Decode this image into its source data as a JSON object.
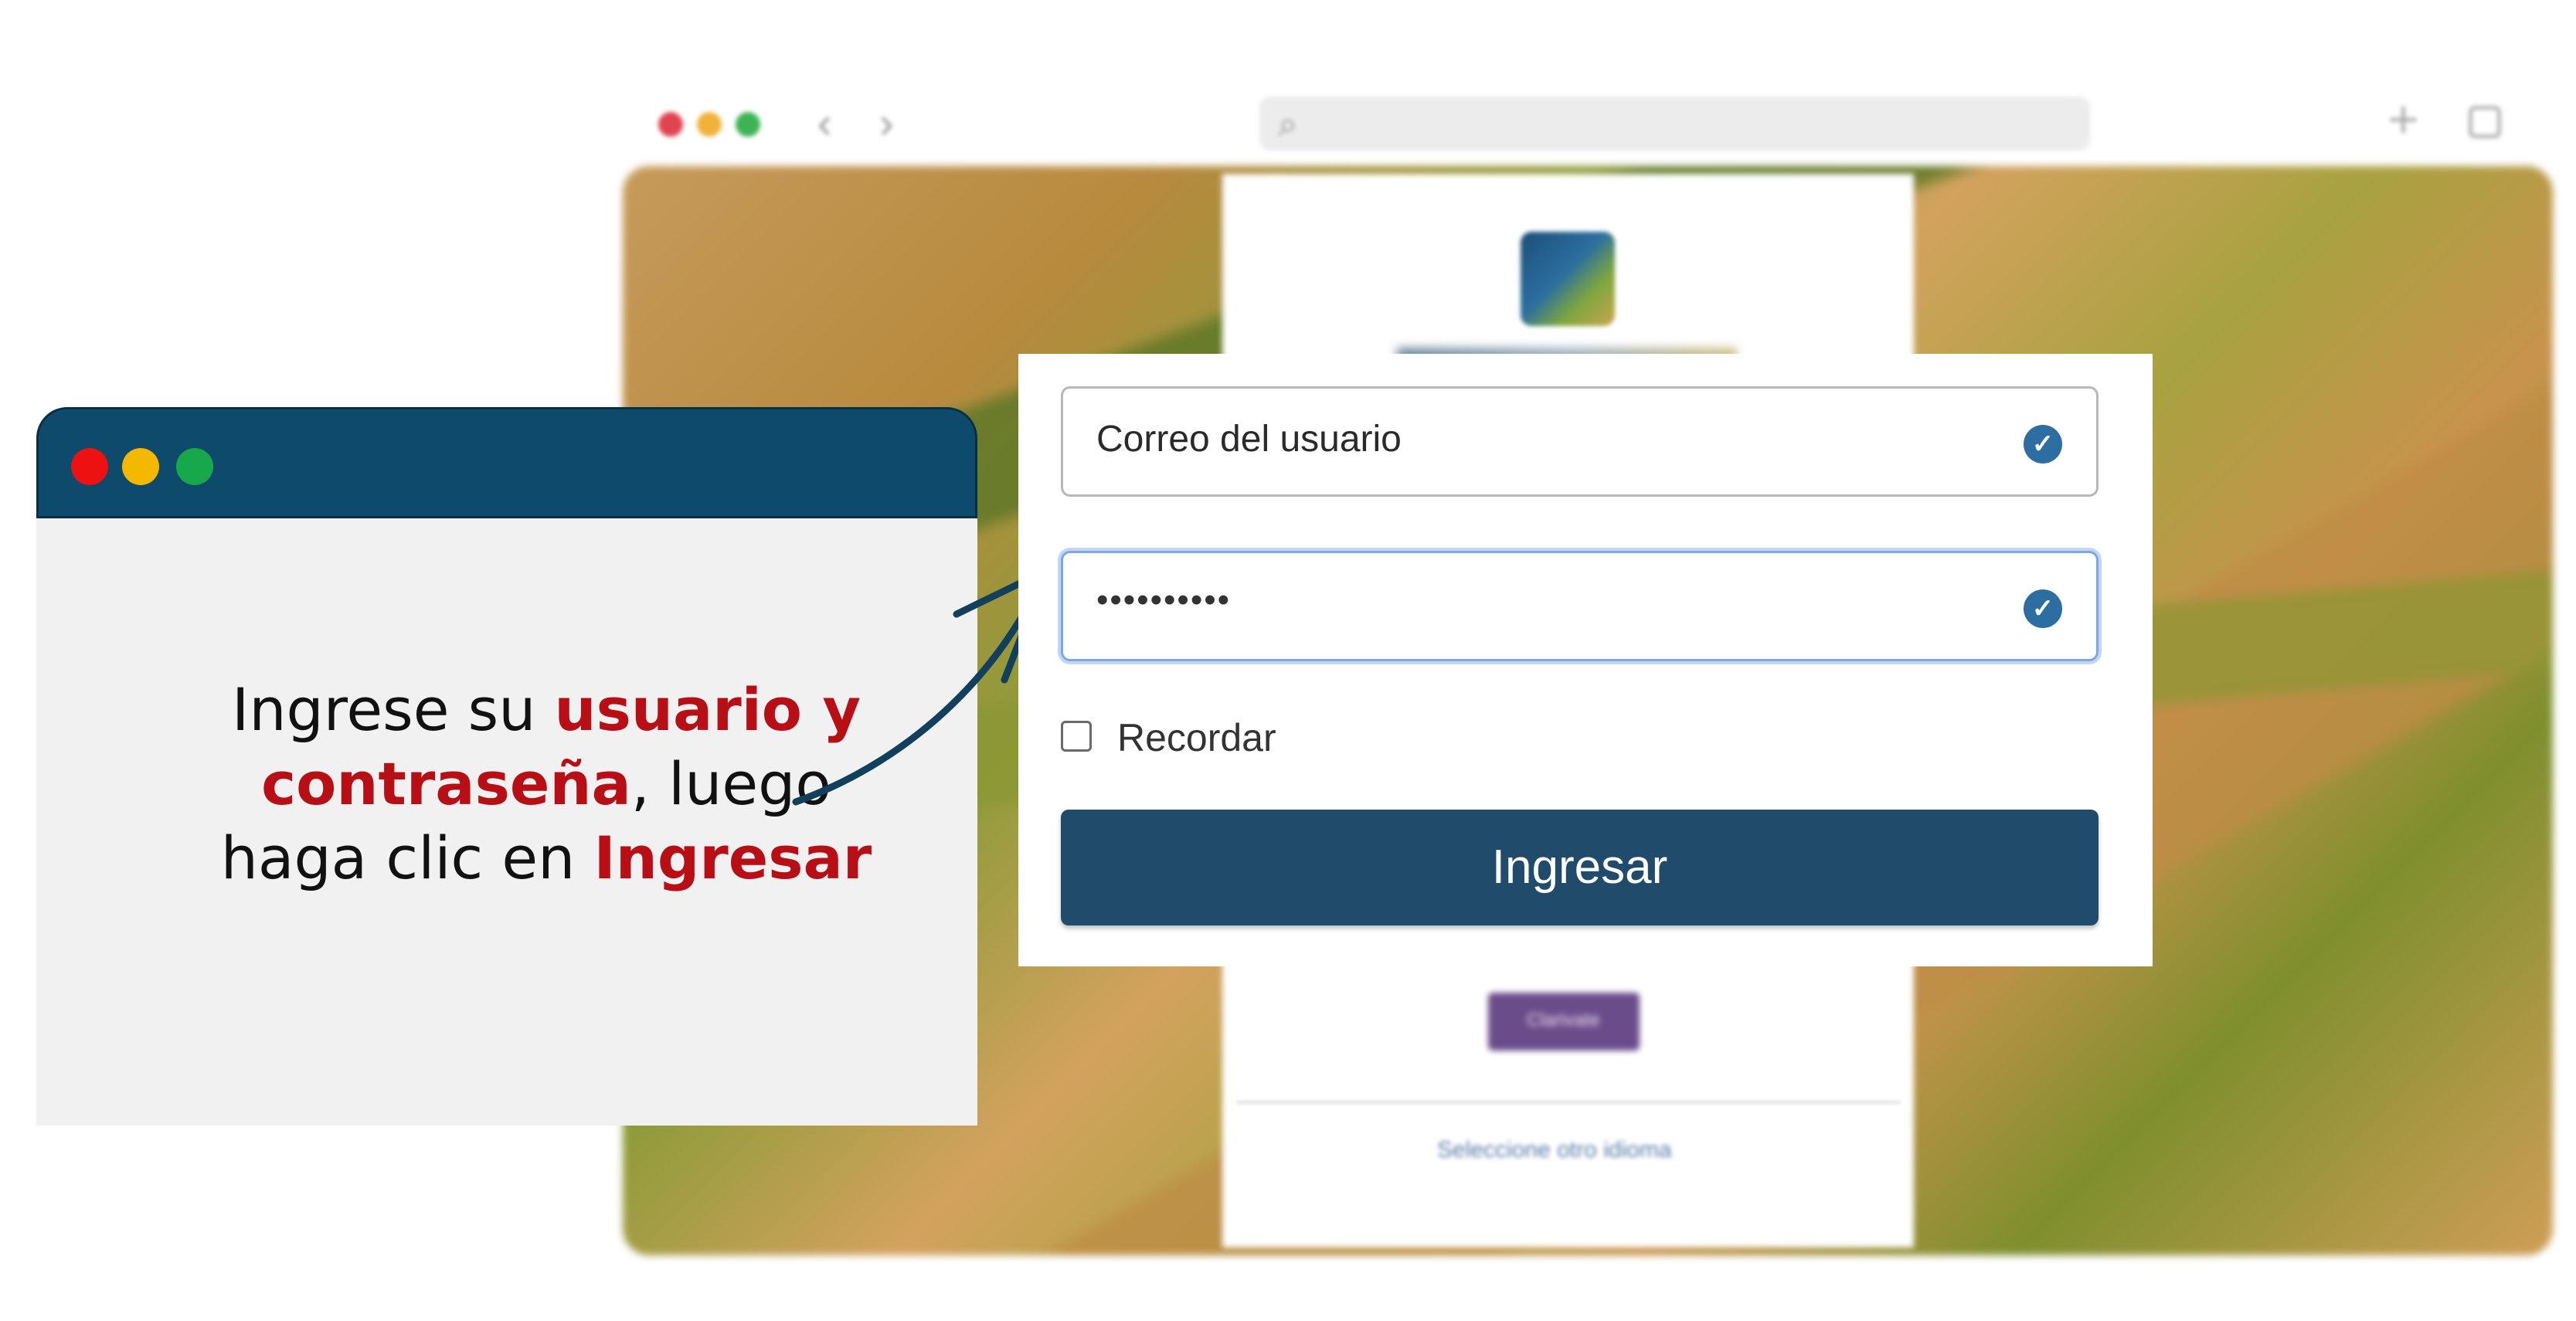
{
  "background_page": {
    "badge_text": "Clarivate",
    "language_link": "Seleccione otro idioma"
  },
  "instruction": {
    "part1": "Ingrese su ",
    "highlight1": "usuario y contraseña",
    "part2": ", luego haga clic en ",
    "highlight2": "Ingresar"
  },
  "login_form": {
    "email_value": "Correo del usuario",
    "password_value": "••••••••••",
    "remember_label": "Recordar",
    "submit_label": "Ingresar"
  },
  "colors": {
    "panel_header": "#0e4a6b",
    "highlight_text": "#b80f16",
    "submit_button": "#204b6a",
    "check_icon": "#2d6ea2"
  }
}
